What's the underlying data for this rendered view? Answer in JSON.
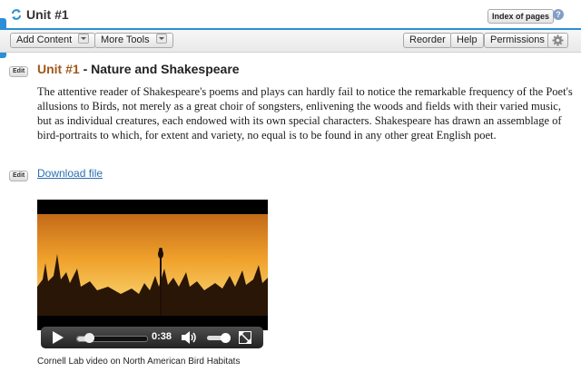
{
  "header": {
    "title": "Unit #1",
    "index_button": "Index of pages",
    "help_icon": "?",
    "accent_color": "#2a8fd6"
  },
  "toolbar": {
    "add_content": "Add Content",
    "more_tools": "More Tools",
    "reorder": "Reorder",
    "help": "Help",
    "permissions": "Permissions"
  },
  "content": {
    "edit_label": "Edit",
    "title_unit": "Unit #1",
    "title_separator": " - ",
    "title_text": "Nature and Shakespeare",
    "paragraph": "The attentive reader of Shakespeare's poems and plays can hardly fail to notice the remarkable frequency of the Poet's allusions to Birds, not merely as a great choir of songsters, enlivening the woods and fields with their varied music, but as individual creatures, each endowed with its own special characters. Shakespeare has drawn an assemblage of bird-portraits to which, for extent and variety, no equal is to be found in any other great English poet.",
    "download_edit_label": "Edit",
    "download_link": "Download file"
  },
  "video": {
    "time": "0:38",
    "progress": 0.18,
    "volume": 0.7,
    "caption": "Cornell Lab video on North American Bird Habitats"
  }
}
